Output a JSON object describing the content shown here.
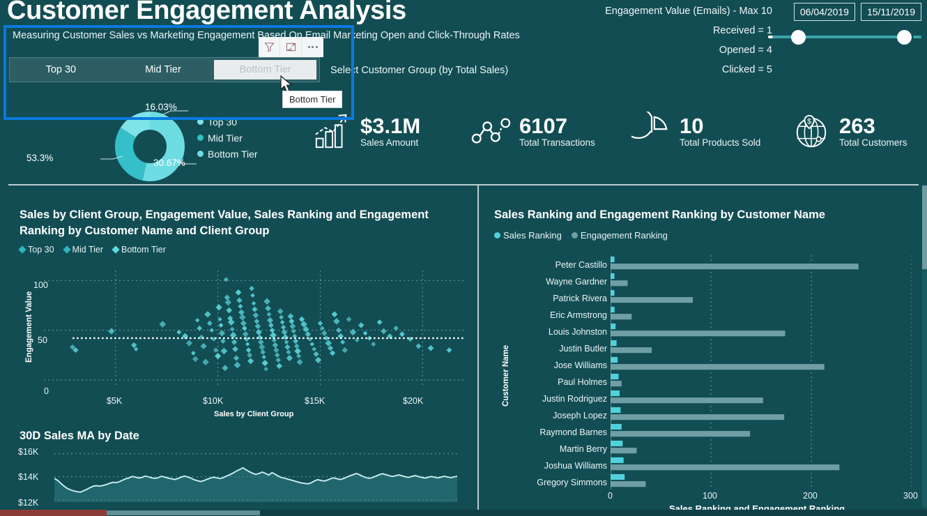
{
  "header": {
    "title": "Customer Engagement Analysis",
    "subtitle": "Measuring Customer Sales vs Marketing Engagement Based On Email Marketing Open and Click-Through Rates",
    "select_group_label": "Select Customer Group (by Total Sales)"
  },
  "toolbar": {
    "filter_icon": "filter-funnel-icon",
    "focus_icon": "focus-mode-icon",
    "more_icon": "more-options-icon"
  },
  "slicer": {
    "items": [
      {
        "label": "Top 30",
        "state": "normal"
      },
      {
        "label": "Mid Tier",
        "state": "normal"
      },
      {
        "label": "Bottom Tier",
        "state": "hovered"
      }
    ],
    "tooltip": "Bottom Tier"
  },
  "metrics": {
    "heading": "Engagement Value (Emails) - Max 10",
    "lines": [
      "Received = 1",
      "Opened = 4",
      "Clicked = 5"
    ]
  },
  "date_range": {
    "start": "06/04/2019",
    "end": "15/11/2019",
    "slider_left_pct": 18,
    "slider_right_pct": 94
  },
  "kpis": [
    {
      "value": "$3.1M",
      "label": "Sales Amount",
      "icon": "bar-chart-growth-icon"
    },
    {
      "value": "6107",
      "label": "Total Transactions",
      "icon": "network-nodes-icon"
    },
    {
      "value": "10",
      "label": "Total Products Sold",
      "icon": "pie-chart-icon"
    },
    {
      "value": "263",
      "label": "Total Customers",
      "icon": "globe-dollar-pin-icon"
    }
  ],
  "colors": {
    "page_bg": "#134d54",
    "accent_cyan": "#5ddbe0",
    "accent_teal": "#2fb5bd",
    "bar_muted": "#54868d",
    "selection_blue": "#0a79de",
    "divider": "#b9cfd2",
    "text_light": "#eaf6f7"
  },
  "chart_data": [
    {
      "id": "client-group-donut",
      "type": "pie",
      "title": "",
      "labels": [
        "Top 30",
        "Mid Tier",
        "Bottom Tier"
      ],
      "values": [
        16.03,
        30.67,
        53.3
      ],
      "value_labels": [
        "16.03%",
        "30.67%",
        "53.3%"
      ],
      "colors": [
        "#7fe3e8",
        "#35bfc8",
        "#6ddce2"
      ],
      "legend": [
        "Top 30",
        "Mid Tier",
        "Bottom Tier"
      ],
      "legend_position": "right",
      "donut": true
    },
    {
      "id": "sales-engagement-scatter",
      "type": "scatter",
      "title": "Sales by Client Group, Engagement Value, Sales Ranking and Engagement Ranking by Customer Name and Client Group",
      "xlabel": "Sales by Client Group",
      "ylabel": "Engagement Value",
      "legend": [
        "Top 30",
        "Mid Tier",
        "Bottom Tier"
      ],
      "legend_colors": [
        "#2fb5bd",
        "#2fb5bd",
        "#5ddbe0"
      ],
      "xticks": [
        "$5K",
        "$10K",
        "$15K",
        "$20K"
      ],
      "xtick_values": [
        5000,
        10000,
        15000,
        20000
      ],
      "yticks": [
        "0",
        "50",
        "100"
      ],
      "ytick_values": [
        0,
        50,
        100
      ],
      "xlim": [
        1500,
        22000
      ],
      "ylim": [
        -5,
        110
      ],
      "grid": true,
      "reference_line_y": 42,
      "marker": "diamond",
      "points": [
        [
          2900,
          33
        ],
        [
          3050,
          30
        ],
        [
          4800,
          49
        ],
        [
          5900,
          35
        ],
        [
          6000,
          31
        ],
        [
          7300,
          56
        ],
        [
          8100,
          48
        ],
        [
          8400,
          44
        ],
        [
          8600,
          37
        ],
        [
          8800,
          27
        ],
        [
          8900,
          21
        ],
        [
          9000,
          60
        ],
        [
          9100,
          52
        ],
        [
          9200,
          43
        ],
        [
          9300,
          34
        ],
        [
          9400,
          18
        ],
        [
          9500,
          66
        ],
        [
          9600,
          57
        ],
        [
          9700,
          50
        ],
        [
          9800,
          41
        ],
        [
          9900,
          30
        ],
        [
          10000,
          24
        ],
        [
          10050,
          73
        ],
        [
          10100,
          61
        ],
        [
          10150,
          55
        ],
        [
          10200,
          47
        ],
        [
          10250,
          39
        ],
        [
          10300,
          29
        ],
        [
          10350,
          12
        ],
        [
          10400,
          101
        ],
        [
          10450,
          83
        ],
        [
          10500,
          78
        ],
        [
          10550,
          70
        ],
        [
          10600,
          62
        ],
        [
          10650,
          58
        ],
        [
          10700,
          51
        ],
        [
          10750,
          45
        ],
        [
          10800,
          38
        ],
        [
          10850,
          31
        ],
        [
          10900,
          22
        ],
        [
          10950,
          15
        ],
        [
          11000,
          88
        ],
        [
          11050,
          80
        ],
        [
          11100,
          74
        ],
        [
          11150,
          68
        ],
        [
          11200,
          63
        ],
        [
          11250,
          57
        ],
        [
          11300,
          52
        ],
        [
          11350,
          46
        ],
        [
          11400,
          41
        ],
        [
          11450,
          36
        ],
        [
          11500,
          30
        ],
        [
          11550,
          25
        ],
        [
          11600,
          19
        ],
        [
          11650,
          92
        ],
        [
          11700,
          85
        ],
        [
          11750,
          77
        ],
        [
          11800,
          71
        ],
        [
          11850,
          65
        ],
        [
          11900,
          59
        ],
        [
          11950,
          54
        ],
        [
          12000,
          48
        ],
        [
          12050,
          43
        ],
        [
          12100,
          38
        ],
        [
          12150,
          33
        ],
        [
          12200,
          28
        ],
        [
          12250,
          23
        ],
        [
          12300,
          17
        ],
        [
          12350,
          11
        ],
        [
          12400,
          79
        ],
        [
          12450,
          72
        ],
        [
          12500,
          66
        ],
        [
          12550,
          60
        ],
        [
          12600,
          55
        ],
        [
          12650,
          50
        ],
        [
          12700,
          45
        ],
        [
          12750,
          40
        ],
        [
          12800,
          35
        ],
        [
          12850,
          30
        ],
        [
          12900,
          25
        ],
        [
          12950,
          20
        ],
        [
          13000,
          14
        ],
        [
          13050,
          69
        ],
        [
          13100,
          63
        ],
        [
          13150,
          58
        ],
        [
          13200,
          53
        ],
        [
          13250,
          48
        ],
        [
          13300,
          43
        ],
        [
          13350,
          38
        ],
        [
          13400,
          33
        ],
        [
          13450,
          28
        ],
        [
          13500,
          22
        ],
        [
          13550,
          64
        ],
        [
          13600,
          59
        ],
        [
          13650,
          54
        ],
        [
          13700,
          49
        ],
        [
          13750,
          44
        ],
        [
          13800,
          39
        ],
        [
          13850,
          34
        ],
        [
          13900,
          29
        ],
        [
          13950,
          24
        ],
        [
          14000,
          18
        ],
        [
          14100,
          61
        ],
        [
          14200,
          56
        ],
        [
          14300,
          51
        ],
        [
          14400,
          46
        ],
        [
          14500,
          41
        ],
        [
          14600,
          36
        ],
        [
          14700,
          31
        ],
        [
          14800,
          26
        ],
        [
          14900,
          20
        ],
        [
          15000,
          57
        ],
        [
          15100,
          52
        ],
        [
          15200,
          47
        ],
        [
          15300,
          42
        ],
        [
          15400,
          37
        ],
        [
          15500,
          32
        ],
        [
          15600,
          27
        ],
        [
          15700,
          66
        ],
        [
          15800,
          59
        ],
        [
          15900,
          50
        ],
        [
          16000,
          44
        ],
        [
          16100,
          38
        ],
        [
          16200,
          30
        ],
        [
          16400,
          61
        ],
        [
          16600,
          48
        ],
        [
          16800,
          40
        ],
        [
          17000,
          55
        ],
        [
          17200,
          47
        ],
        [
          17400,
          42
        ],
        [
          17600,
          36
        ],
        [
          17900,
          58
        ],
        [
          18100,
          49
        ],
        [
          18400,
          44
        ],
        [
          18700,
          52
        ],
        [
          19000,
          46
        ],
        [
          19400,
          41
        ],
        [
          19800,
          34
        ],
        [
          20400,
          32
        ],
        [
          21300,
          30
        ]
      ]
    },
    {
      "id": "sales-ma-area",
      "type": "area",
      "title": "30D Sales MA by Date",
      "xlabel": "",
      "ylabel": "",
      "yticks": [
        "$16K",
        "$14K",
        "$12K"
      ],
      "ytick_values": [
        16000,
        14000,
        12000
      ],
      "ylim": [
        11800,
        16400
      ],
      "grid": true,
      "values": [
        13850,
        13680,
        13420,
        13180,
        12980,
        12860,
        12760,
        12700,
        12660,
        12780,
        12900,
        13060,
        13180,
        13220,
        13180,
        13240,
        13320,
        13420,
        13520,
        13480,
        13560,
        13700,
        13820,
        13900,
        14020,
        13960,
        13880,
        13940,
        14060,
        13980,
        13900,
        13860,
        13920,
        14040,
        13960,
        13880,
        13820,
        13760,
        13840,
        13960,
        14060,
        13980,
        13880,
        13740,
        13660,
        13580,
        13660,
        13780,
        13880,
        13960,
        13900,
        13840,
        13920,
        14060,
        14180,
        14320,
        14480,
        14620,
        14780,
        14600,
        14440,
        14300,
        14200,
        14280,
        14400,
        14280,
        14140,
        14360,
        14200,
        14040,
        13920,
        13860,
        13780,
        13700,
        13620,
        13540,
        13460,
        13420,
        13380,
        13460,
        13620,
        13740,
        13680,
        13620,
        13700,
        13820,
        13900,
        13820,
        13760,
        13840,
        13960,
        14080,
        14180,
        14280,
        14160,
        14020,
        13920,
        13860,
        13940,
        14060,
        14180,
        14260,
        14180,
        14100,
        14020,
        14080,
        14160,
        14080,
        14000,
        13940,
        14020,
        14100,
        14020,
        13940,
        13880,
        13940,
        14020,
        13960,
        13900,
        13960,
        14040,
        13980,
        13920,
        13980,
        14040
      ]
    },
    {
      "id": "ranking-bar",
      "type": "bar",
      "orientation": "horizontal",
      "title": "Sales Ranking and Engagement Ranking by Customer Name",
      "xlabel": "Sales Ranking and Engagement Ranking",
      "ylabel": "Customer Name",
      "xticks": [
        "0",
        "100",
        "200",
        "300"
      ],
      "xtick_values": [
        0,
        100,
        200,
        300
      ],
      "xlim": [
        0,
        300
      ],
      "grid": true,
      "legend": [
        "Sales Ranking",
        "Engagement Ranking"
      ],
      "legend_colors": [
        "#4fd2db",
        "#6f9ea4"
      ],
      "categories": [
        "Peter Castillo",
        "Wayne Gardner",
        "Patrick Rivera",
        "Eric Armstrong",
        "Louis Johnston",
        "Justin Butler",
        "Jose Williams",
        "Paul Holmes",
        "Justin Rodriguez",
        "Joseph Lopez",
        "Raymond Barnes",
        "Martin Berry",
        "Joshua Williams",
        "Gregory Simmons"
      ],
      "series": [
        {
          "name": "Sales Ranking",
          "values": [
            1,
            2,
            3,
            4,
            5,
            6,
            7,
            8,
            9,
            10,
            11,
            12,
            13,
            14
          ]
        },
        {
          "name": "Engagement Ranking",
          "values": [
            247,
            17,
            82,
            21,
            174,
            41,
            213,
            11,
            152,
            173,
            139,
            26,
            228,
            35
          ]
        }
      ]
    }
  ]
}
